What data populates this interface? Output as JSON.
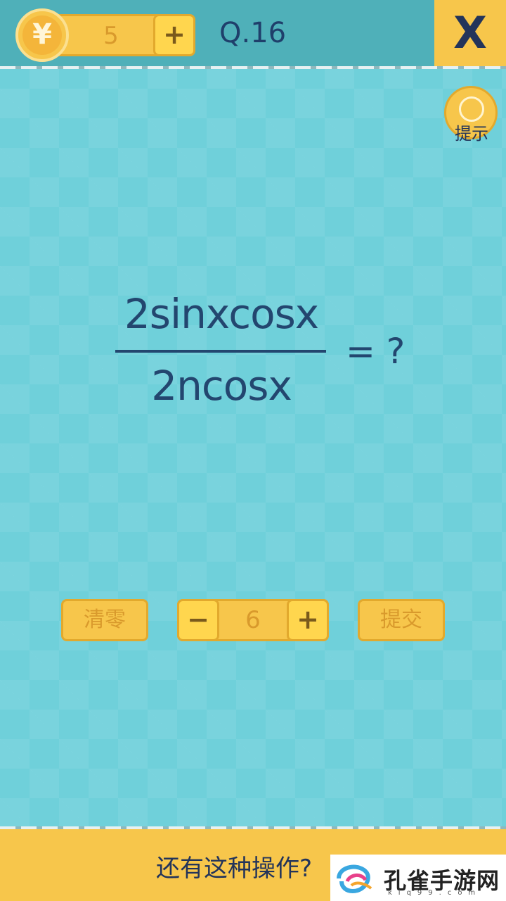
{
  "header": {
    "coin_symbol": "¥",
    "coin_count": "5",
    "add_coins_label": "+",
    "question_number": "Q.16",
    "close_label": "X"
  },
  "hint": {
    "icon": "lightbulb-icon",
    "label": "提示"
  },
  "puzzle": {
    "numerator": "2sinxcosx",
    "denominator": "2ncosx",
    "equals": "= ?"
  },
  "controls": {
    "clear_label": "清零",
    "decrement_label": "−",
    "answer_value": "6",
    "increment_label": "+",
    "submit_label": "提交"
  },
  "footer": {
    "text": "还有这种操作?"
  },
  "watermark": {
    "name": "孔雀手游网",
    "url": "kiq99.com"
  },
  "colors": {
    "background": "#6fd0da",
    "topbar": "#4fb0b9",
    "button_yellow": "#f7c64b",
    "text_navy": "#23466f"
  }
}
